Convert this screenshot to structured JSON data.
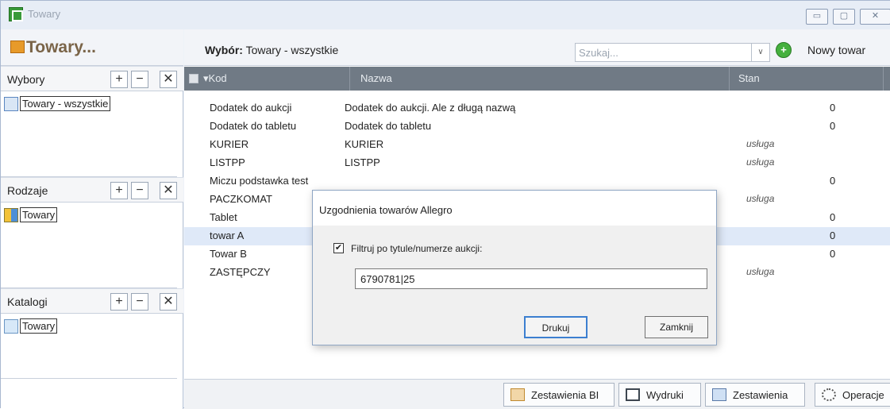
{
  "window": {
    "title": "Towary"
  },
  "window_buttons": {
    "minimize": "▭",
    "maximize": "▢",
    "close": "✕"
  },
  "left": {
    "header": "Towary...",
    "sections": [
      {
        "label": "Wybory",
        "plus": "+",
        "minus": "−",
        "close": "✕",
        "item": "Towary - wszystkie",
        "icon": "search-list-icon"
      },
      {
        "label": "Rodzaje",
        "plus": "+",
        "minus": "−",
        "close": "✕",
        "item": "Towary",
        "icon": "grid-icon"
      },
      {
        "label": "Katalogi",
        "plus": "+",
        "minus": "−",
        "close": "✕",
        "item": "Towary",
        "icon": "folder-icon"
      }
    ]
  },
  "toolbar": {
    "selection_label": "Wybór:",
    "selection_value": "Towary - wszystkie",
    "search_placeholder": "Szukaj...",
    "dropdown_glyph": "∨",
    "add_glyph": "+",
    "new_item": "Nowy towar"
  },
  "grid": {
    "columns": [
      "▾Kod",
      "Nazwa",
      "Stan"
    ],
    "rows": [
      {
        "kod": "Dodatek do aukcji",
        "nazwa": "Dodatek do aukcji. Ale z długą nazwą",
        "typ": "",
        "stan": "0"
      },
      {
        "kod": "Dodatek do tabletu",
        "nazwa": "Dodatek do tabletu",
        "typ": "",
        "stan": "0"
      },
      {
        "kod": "KURIER",
        "nazwa": "KURIER",
        "typ": "usługa",
        "stan": ""
      },
      {
        "kod": "LISTPP",
        "nazwa": "LISTPP",
        "typ": "usługa",
        "stan": ""
      },
      {
        "kod": "Miczu podstawka test",
        "nazwa": "",
        "typ": "",
        "stan": "0"
      },
      {
        "kod": "PACZKOMAT",
        "nazwa": "",
        "typ": "usługa",
        "stan": ""
      },
      {
        "kod": "Tablet",
        "nazwa": "",
        "typ": "",
        "stan": "0"
      },
      {
        "kod": "towar A",
        "nazwa": "",
        "typ": "",
        "stan": "0"
      },
      {
        "kod": "Towar B",
        "nazwa": "",
        "typ": "",
        "stan": "0"
      },
      {
        "kod": "ZASTĘPCZY",
        "nazwa": "",
        "typ": "usługa",
        "stan": ""
      }
    ]
  },
  "bottom": {
    "buttons": [
      "Zestawienia BI",
      "Wydruki",
      "Zestawienia",
      "Operacje"
    ]
  },
  "dialog": {
    "title": "Uzgodnienia towarów Allegro",
    "checkbox_label": "Filtruj po tytule/numerze aukcji:",
    "checkbox_checked": "✔",
    "input_value": "6790781|25",
    "print_button": "Drukuj",
    "close_button": "Zamknij"
  }
}
